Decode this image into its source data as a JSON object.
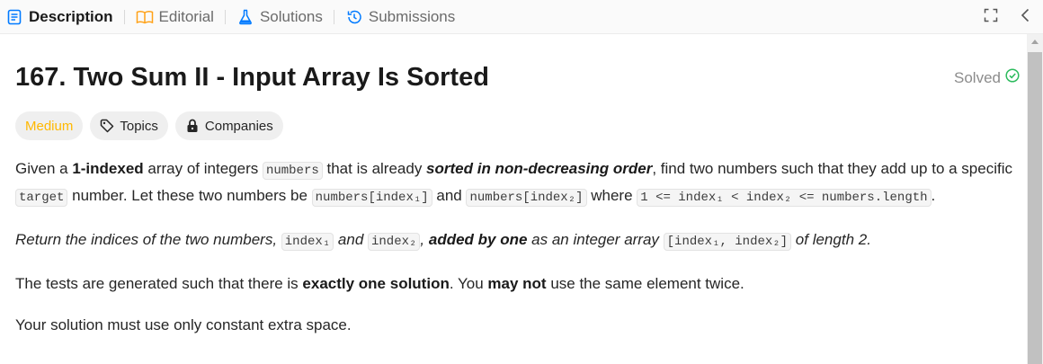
{
  "tabs": [
    {
      "label": "Description",
      "icon": "description-icon",
      "active": true
    },
    {
      "label": "Editorial",
      "icon": "book-icon",
      "active": false
    },
    {
      "label": "Solutions",
      "icon": "flask-icon",
      "active": false
    },
    {
      "label": "Submissions",
      "icon": "history-icon",
      "active": false
    }
  ],
  "problem": {
    "title": "167. Two Sum II - Input Array Is Sorted",
    "status": "Solved",
    "difficulty": "Medium",
    "chips": {
      "topics": "Topics",
      "companies": "Companies"
    }
  },
  "description": {
    "p1": {
      "t1": "Given a ",
      "b1": "1-indexed",
      "t2": " array of integers ",
      "c1": "numbers",
      "t3": " that is already ",
      "i1": "sorted in non-decreasing order",
      "t4": ", find two numbers such that they add up to a specific ",
      "c2": "target",
      "t5": " number. Let these two numbers be ",
      "c3": "numbers[index₁]",
      "t6": " and ",
      "c4": "numbers[index₂]",
      "t7": " where ",
      "c5": "1 <= index₁ < index₂ <= numbers.length",
      "t8": "."
    },
    "p2": {
      "i1": "Return the indices of the two numbers, ",
      "c1": "index₁",
      "i2": " and ",
      "c2": "index₂",
      "i3": ", ",
      "b1": "added by one",
      "i4": " as an integer array ",
      "c3": "[index₁, index₂]",
      "i5": " of length 2."
    },
    "p3": {
      "t1": "The tests are generated such that there is ",
      "b1": "exactly one solution",
      "t2": ". You ",
      "b2": "may not",
      "t3": " use the same element twice."
    },
    "p4": {
      "t1": "Your solution must use only constant extra space."
    }
  },
  "colors": {
    "medium": "#ffb800",
    "solved_check": "#2cbb5d",
    "tab_active_icon": "#007aff"
  }
}
